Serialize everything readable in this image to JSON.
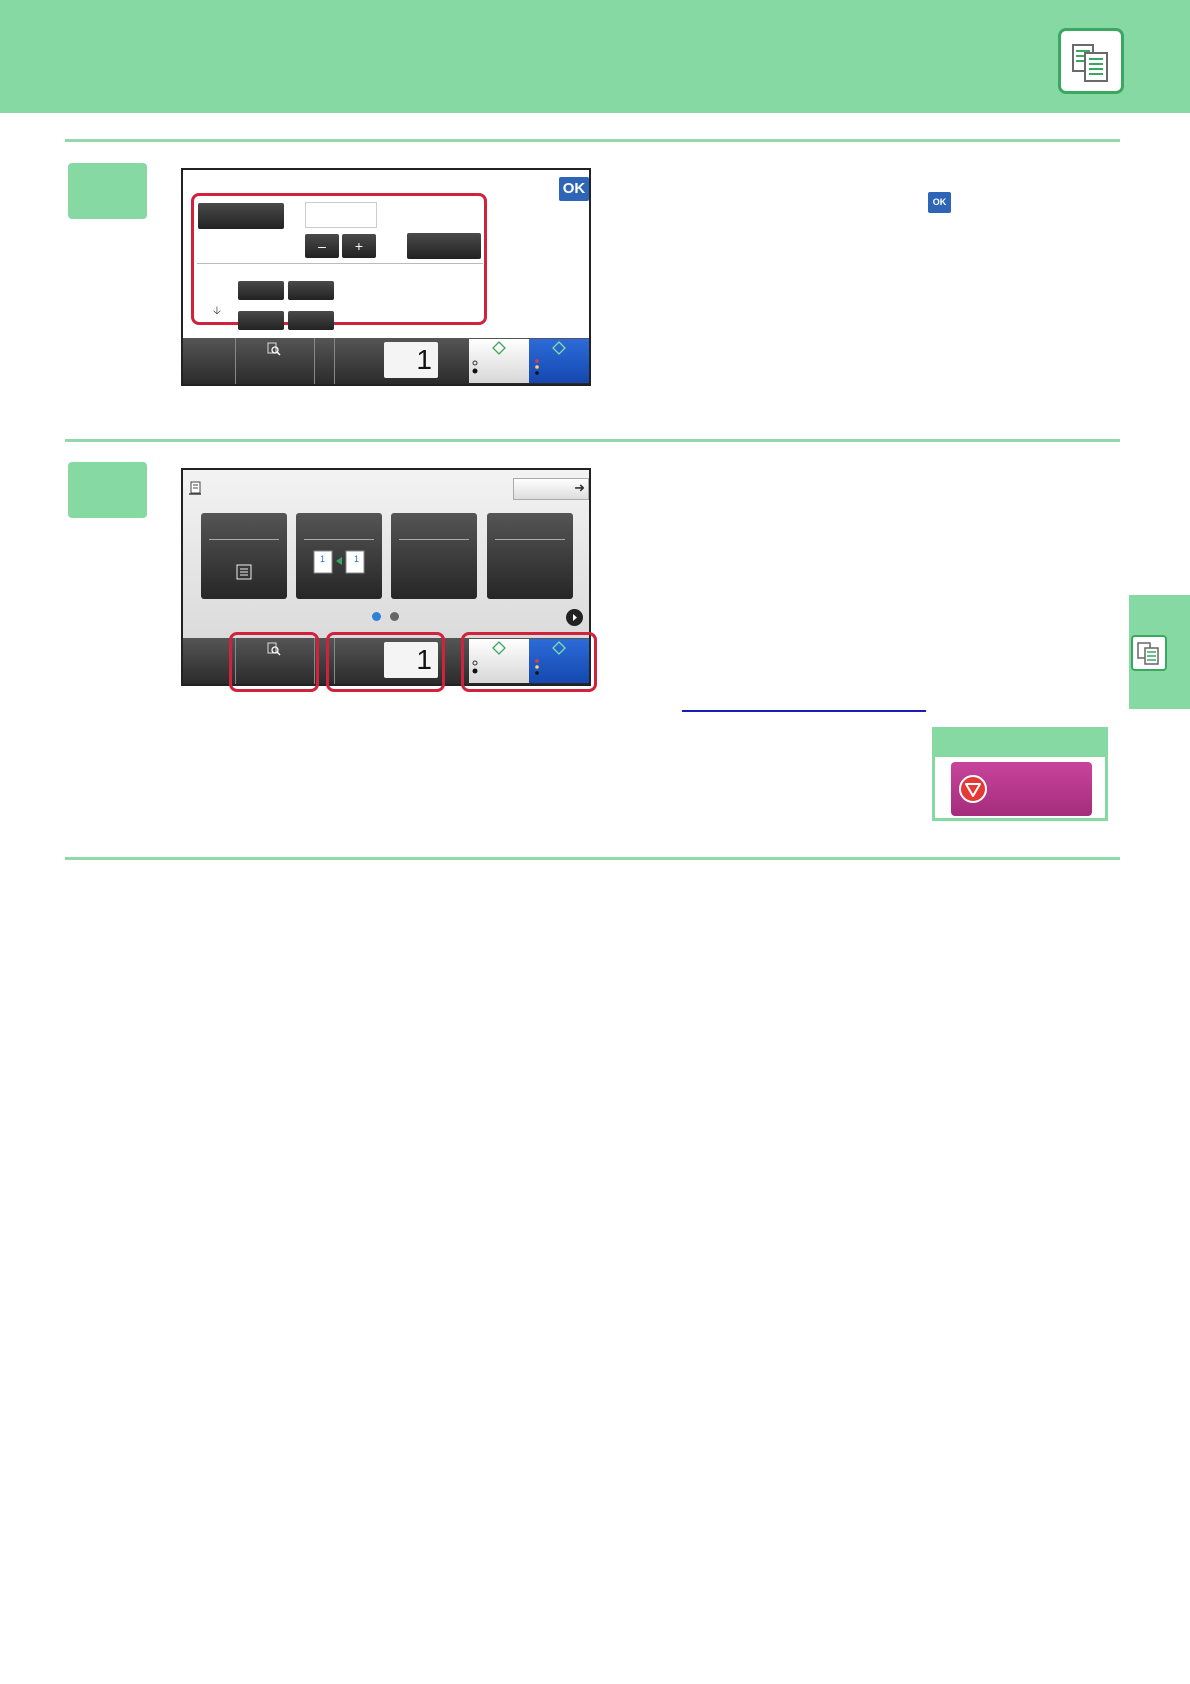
{
  "header": {
    "icon": "copy-mode-icon",
    "accent_color": "#86d9a2"
  },
  "side_tab": {
    "icon": "copy-mode-icon"
  },
  "step1": {
    "panel": {
      "ok_label": "OK",
      "minus_label": "–",
      "plus_label": "+",
      "count_value": "1"
    },
    "instruction_icon_label": "OK"
  },
  "step2": {
    "panel": {
      "count_value": "1",
      "page_dots": 2,
      "active_dot": 1
    }
  },
  "stop_key": {
    "icon": "stop-icon",
    "color": "#b8388c"
  },
  "colors": {
    "highlight_frame": "#d0223c",
    "color_start": "#1a55c4"
  }
}
